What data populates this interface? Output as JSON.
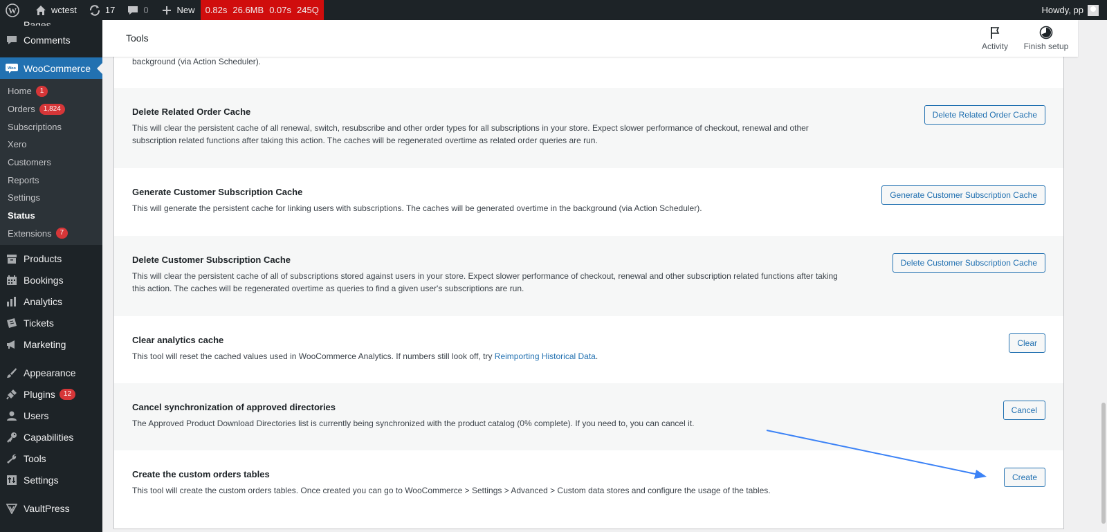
{
  "adminbar": {
    "site_name": "wctest",
    "updates_count": "17",
    "comments_count": "0",
    "new_label": "New",
    "perf": [
      "0.82s",
      "26.6MB",
      "0.07s",
      "245Q"
    ],
    "howdy": "Howdy, pp"
  },
  "sidebar": {
    "pages_label": "Pages",
    "comments_label": "Comments",
    "woocommerce_label": "WooCommerce",
    "wc_submenu": [
      {
        "label": "Home",
        "badge": "1"
      },
      {
        "label": "Orders",
        "badge": "1,824"
      },
      {
        "label": "Subscriptions"
      },
      {
        "label": "Xero"
      },
      {
        "label": "Customers"
      },
      {
        "label": "Reports"
      },
      {
        "label": "Settings"
      },
      {
        "label": "Status"
      },
      {
        "label": "Extensions",
        "badge": "7"
      }
    ],
    "menu": [
      {
        "label": "Products"
      },
      {
        "label": "Bookings"
      },
      {
        "label": "Analytics"
      },
      {
        "label": "Tickets"
      },
      {
        "label": "Marketing"
      },
      {
        "label": "Appearance"
      },
      {
        "label": "Plugins",
        "badge": "12"
      },
      {
        "label": "Users"
      },
      {
        "label": "Capabilities"
      },
      {
        "label": "Tools"
      },
      {
        "label": "Settings"
      },
      {
        "label": "VaultPress"
      }
    ]
  },
  "header": {
    "title": "Tools",
    "activity_label": "Activity",
    "finish_setup_label": "Finish setup"
  },
  "tools": {
    "partial_desc": "background (via Action Scheduler).",
    "rows": [
      {
        "name": "Delete Related Order Cache",
        "desc": "This will clear the persistent cache of all renewal, switch, resubscribe and other order types for all subscriptions in your store. Expect slower performance of checkout, renewal and other subscription related functions after taking this action. The caches will be regenerated overtime as related order queries are run.",
        "button": "Delete Related Order Cache"
      },
      {
        "name": "Generate Customer Subscription Cache",
        "desc": "This will generate the persistent cache for linking users with subscriptions. The caches will be generated overtime in the background (via Action Scheduler).",
        "button": "Generate Customer Subscription Cache"
      },
      {
        "name": "Delete Customer Subscription Cache",
        "desc": "This will clear the persistent cache of all of subscriptions stored against users in your store. Expect slower performance of checkout, renewal and other subscription related functions after taking this action. The caches will be regenerated overtime as queries to find a given user's subscriptions are run.",
        "button": "Delete Customer Subscription Cache"
      },
      {
        "name": "Clear analytics cache",
        "desc": "This tool will reset the cached values used in WooCommerce Analytics. If numbers still look off, try",
        "link": "Reimporting Historical Data",
        "desc_end": ".",
        "button": "Clear"
      },
      {
        "name": "Cancel synchronization of approved directories",
        "desc": "The Approved Product Download Directories list is currently being synchronized with the product catalog (0% complete). If you need to, you can cancel it.",
        "button": "Cancel"
      },
      {
        "name": "Create the custom orders tables",
        "desc": "This tool will create the custom orders tables. Once created you can go to WooCommerce > Settings > Advanced > Custom data stores and configure the usage of the tables.",
        "button": "Create"
      }
    ]
  },
  "colors": {
    "admin_bar": "#1d2327",
    "accent": "#2271b1",
    "perf_bg": "#d00d0d",
    "badge": "#d63638",
    "annotation_arrow": "#3b82f6"
  }
}
